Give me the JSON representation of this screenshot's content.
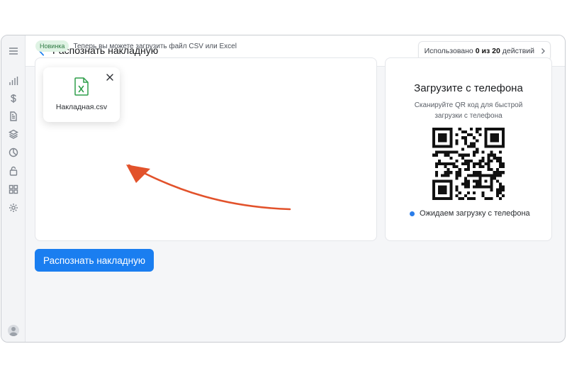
{
  "header": {
    "title": "Распознать накладную",
    "usage": {
      "prefix": "Использовано",
      "used": "0 из 20",
      "suffix": "действий"
    }
  },
  "sidebar": {
    "items": [
      "menu-icon",
      "chart-icon",
      "dollar-icon",
      "document-icon",
      "layers-icon",
      "pie-icon",
      "lock-icon",
      "grid-icon",
      "gear-icon"
    ]
  },
  "notice": {
    "badge": "Новинка",
    "text": "Теперь вы можете загрузить файл CSV или Excel"
  },
  "upload": {
    "file_name": "Накладная.csv"
  },
  "phone": {
    "title": "Загрузите с телефона",
    "subtitle": "Сканируйте QR код для быстрой загрузки с телефона",
    "status": "Ожидаем загрузку с телефона"
  },
  "actions": {
    "submit_label": "Распознать накладную"
  },
  "colors": {
    "accent": "#1a7ef0",
    "badge_bg": "#dff3e4",
    "file_green": "#2e9e4a",
    "arrow": "#e2522b",
    "status_dot": "#2a7de9"
  }
}
